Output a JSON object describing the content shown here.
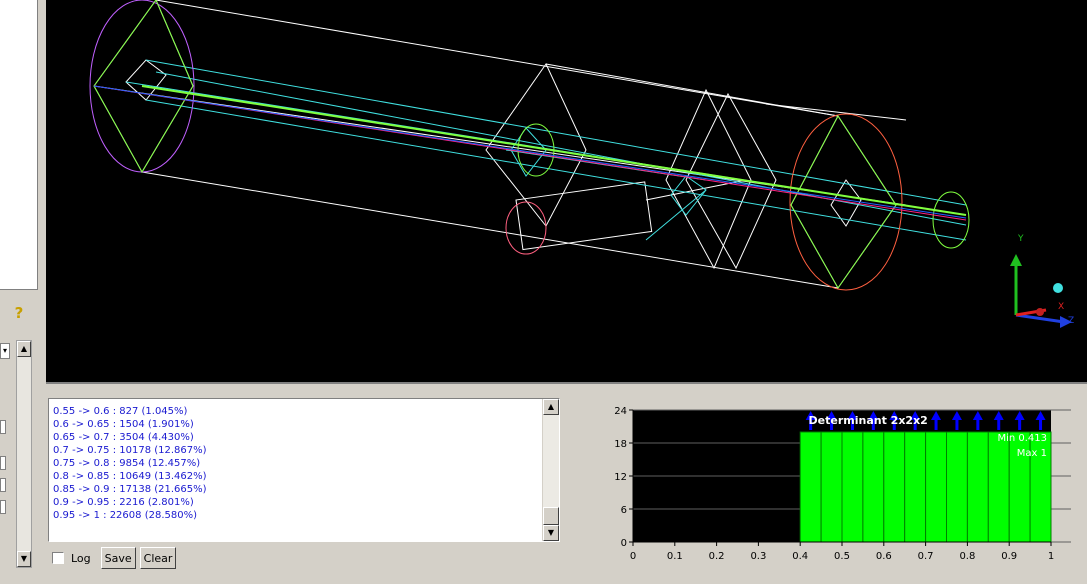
{
  "viewport": {
    "axes": {
      "y_label": "Y",
      "x_label": "X",
      "z_label": "Z"
    },
    "colors": {
      "background": "#000000",
      "wire_white": "#ffffff",
      "wire_cyan": "#40e0e0",
      "wire_green": "#80ff40",
      "axis_green": "#20c020",
      "axis_red": "#e02020",
      "axis_blue": "#2040e0"
    }
  },
  "log": {
    "lines": [
      "0.55 -> 0.6 : 827 (1.045%)",
      "0.6 -> 0.65 : 1504 (1.901%)",
      "0.65 -> 0.7 : 3504 (4.430%)",
      "0.7 -> 0.75 : 10178 (12.867%)",
      "0.75 -> 0.8 : 9854 (12.457%)",
      "0.8 -> 0.85 : 10649 (13.462%)",
      "0.85 -> 0.9 : 17138 (21.665%)",
      "0.9 -> 0.95 : 2216 (2.801%)",
      "0.95 -> 1 : 22608 (28.580%)"
    ],
    "log_label": "Log",
    "save_label": "Save",
    "clear_label": "Clear"
  },
  "chart_data": {
    "type": "bar",
    "title": "Determinant 2x2x2",
    "min_label": "Min 0.413",
    "max_label": "Max 1",
    "x_ticks": [
      "0",
      "0.1",
      "0.2",
      "0.3",
      "0.4",
      "0.5",
      "0.6",
      "0.7",
      "0.8",
      "0.9",
      "1"
    ],
    "y_ticks": [
      "0",
      "6",
      "12",
      "18",
      "24"
    ],
    "xlim": [
      0,
      1
    ],
    "ylim": [
      0,
      24
    ],
    "bins": [
      {
        "x0": 0.4,
        "x1": 0.45,
        "value": 20
      },
      {
        "x0": 0.45,
        "x1": 0.5,
        "value": 20
      },
      {
        "x0": 0.5,
        "x1": 0.55,
        "value": 20
      },
      {
        "x0": 0.55,
        "x1": 0.6,
        "value": 20
      },
      {
        "x0": 0.6,
        "x1": 0.65,
        "value": 20
      },
      {
        "x0": 0.65,
        "x1": 0.7,
        "value": 20
      },
      {
        "x0": 0.7,
        "x1": 0.75,
        "value": 20
      },
      {
        "x0": 0.75,
        "x1": 0.8,
        "value": 20
      },
      {
        "x0": 0.8,
        "x1": 0.85,
        "value": 20
      },
      {
        "x0": 0.85,
        "x1": 0.9,
        "value": 20
      },
      {
        "x0": 0.9,
        "x1": 0.95,
        "value": 20
      },
      {
        "x0": 0.95,
        "x1": 1.0,
        "value": 20
      }
    ],
    "bar_color": "#00ff00",
    "arrow_color": "#0000ff",
    "grid": true
  }
}
